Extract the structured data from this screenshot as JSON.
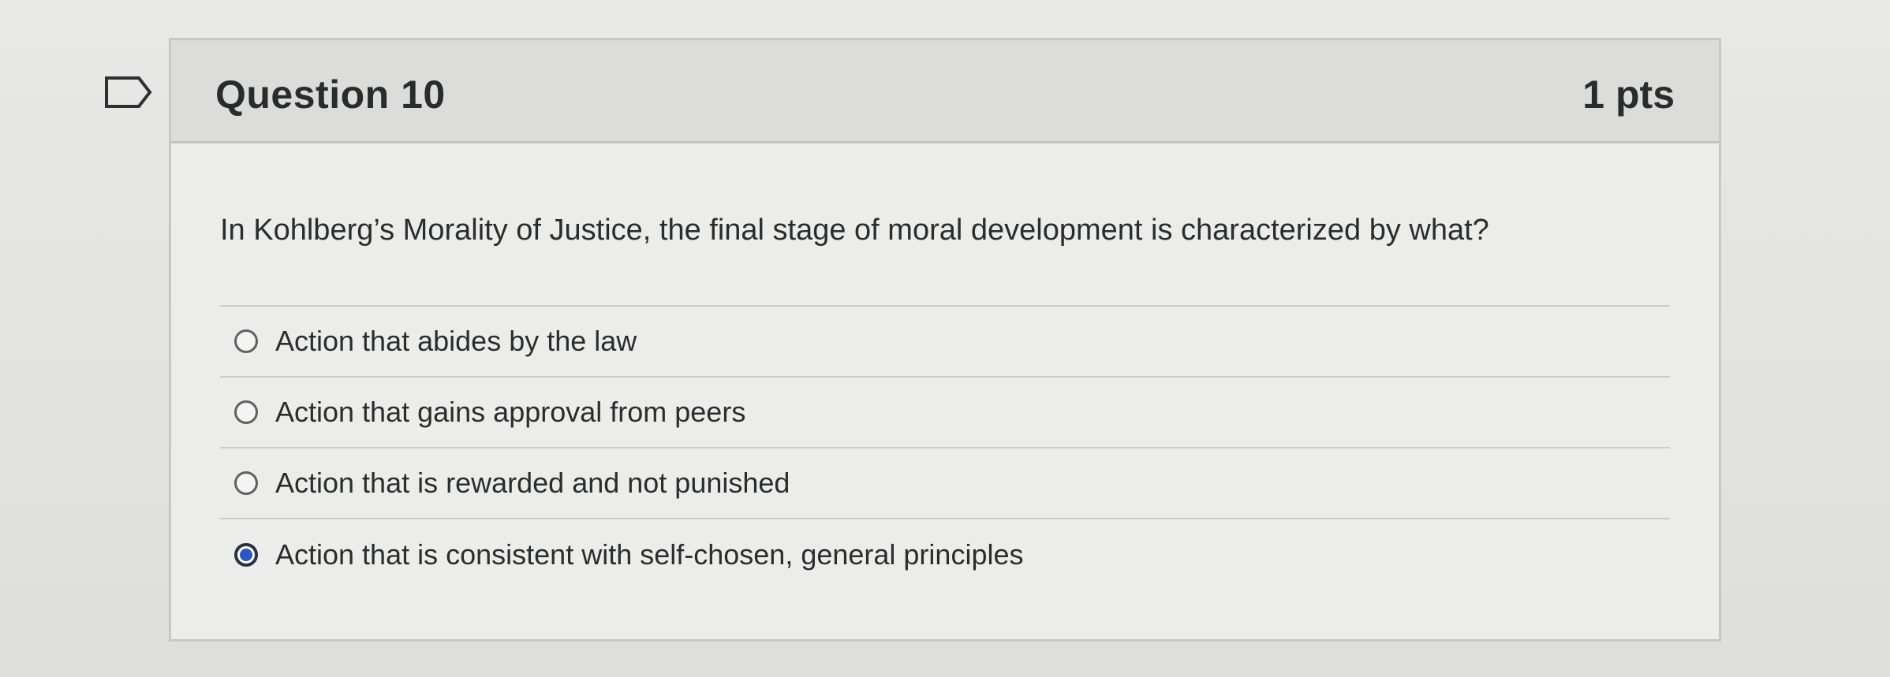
{
  "question": {
    "title": "Question 10",
    "points": "1 pts",
    "text": "In Kohlberg’s Morality of Justice, the final stage of moral development is characterized by what?",
    "flag_icon": "bookmark-flag-icon"
  },
  "answers": [
    {
      "label": "Action that abides by the law",
      "selected": false
    },
    {
      "label": "Action that gains approval from peers",
      "selected": false
    },
    {
      "label": "Action that is rewarded and not punished",
      "selected": false
    },
    {
      "label": "Action that is consistent with self-chosen, general principles",
      "selected": true
    }
  ],
  "colors": {
    "selected_radio": "#2957c7",
    "header_bg": "#dcdddb",
    "card_bg": "#ecedeb"
  }
}
